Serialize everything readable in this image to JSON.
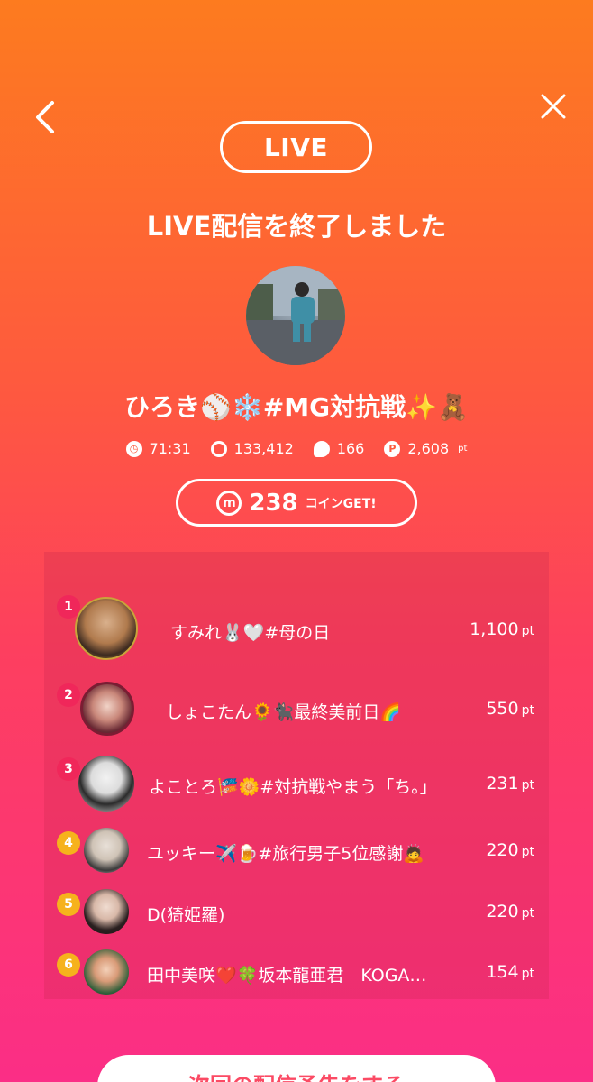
{
  "header": {
    "back_icon": "chevron-left-icon",
    "close_icon": "close-icon",
    "live_label": "LIVE",
    "title": "LIVE配信を終了しました"
  },
  "broadcaster": {
    "name": "ひろき⚾❄️#MG対抗戦✨🧸"
  },
  "stats": {
    "duration": "71:31",
    "views": "133,412",
    "comments": "166",
    "points": "2,608",
    "points_unit": "pt"
  },
  "coins": {
    "icon": "m",
    "count": "238",
    "label": "コインGET!"
  },
  "ranking": [
    {
      "rank": "1",
      "name": "すみれ🐰🤍#母の日",
      "points": "1,100",
      "unit": "pt",
      "badge_color": "#f0275a"
    },
    {
      "rank": "2",
      "name": "しょこたん🌻🐈‍⬛最終美前日🌈",
      "points": "550",
      "unit": "pt",
      "badge_color": "#f0275a"
    },
    {
      "rank": "3",
      "name": "よことろ🎏🌼#対抗戦やまう「ち。」",
      "points": "231",
      "unit": "pt",
      "badge_color": "#f0275a"
    },
    {
      "rank": "4",
      "name": "ユッキー✈️🍺#旅行男子5位感謝🙇",
      "points": "220",
      "unit": "pt",
      "badge_color": "#f6b21c"
    },
    {
      "rank": "5",
      "name": "D(猗姫羅)",
      "points": "220",
      "unit": "pt",
      "badge_color": "#f6b21c"
    },
    {
      "rank": "6",
      "name": "田中美咲❤️🍀坂本龍亜君　KOGA…",
      "points": "154",
      "unit": "pt",
      "badge_color": "#f6b21c"
    }
  ],
  "footer": {
    "next_button": "次回の配信予告をする"
  }
}
